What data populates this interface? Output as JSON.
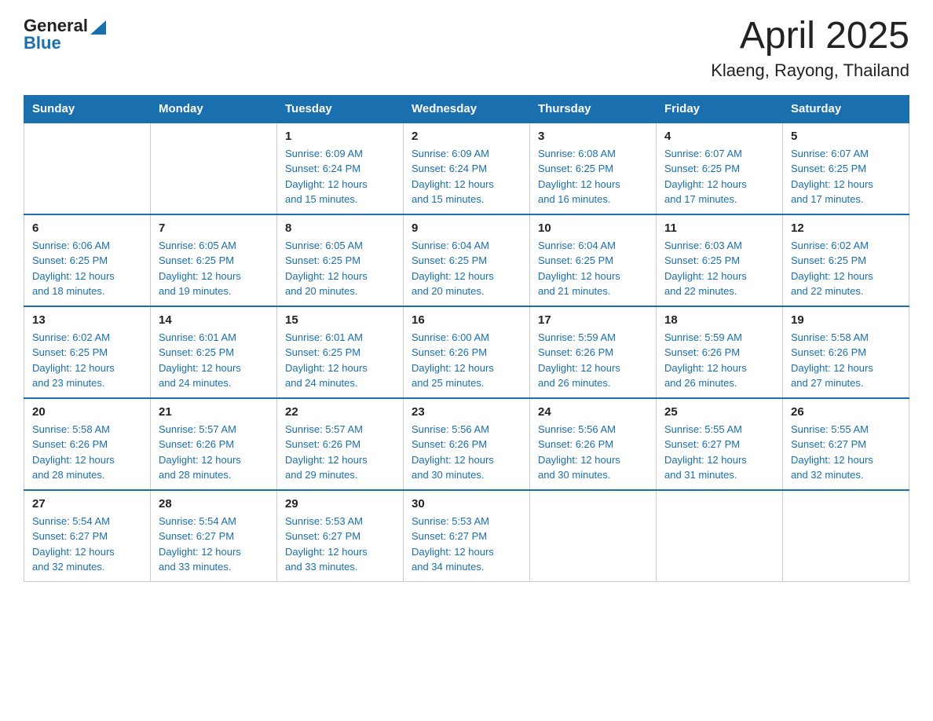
{
  "header": {
    "logo": {
      "general": "General",
      "blue": "Blue",
      "triangle": "▶"
    },
    "title": "April 2025",
    "subtitle": "Klaeng, Rayong, Thailand"
  },
  "calendar": {
    "days_of_week": [
      "Sunday",
      "Monday",
      "Tuesday",
      "Wednesday",
      "Thursday",
      "Friday",
      "Saturday"
    ],
    "weeks": [
      [
        {
          "day": "",
          "info": ""
        },
        {
          "day": "",
          "info": ""
        },
        {
          "day": "1",
          "info": "Sunrise: 6:09 AM\nSunset: 6:24 PM\nDaylight: 12 hours\nand 15 minutes."
        },
        {
          "day": "2",
          "info": "Sunrise: 6:09 AM\nSunset: 6:24 PM\nDaylight: 12 hours\nand 15 minutes."
        },
        {
          "day": "3",
          "info": "Sunrise: 6:08 AM\nSunset: 6:25 PM\nDaylight: 12 hours\nand 16 minutes."
        },
        {
          "day": "4",
          "info": "Sunrise: 6:07 AM\nSunset: 6:25 PM\nDaylight: 12 hours\nand 17 minutes."
        },
        {
          "day": "5",
          "info": "Sunrise: 6:07 AM\nSunset: 6:25 PM\nDaylight: 12 hours\nand 17 minutes."
        }
      ],
      [
        {
          "day": "6",
          "info": "Sunrise: 6:06 AM\nSunset: 6:25 PM\nDaylight: 12 hours\nand 18 minutes."
        },
        {
          "day": "7",
          "info": "Sunrise: 6:05 AM\nSunset: 6:25 PM\nDaylight: 12 hours\nand 19 minutes."
        },
        {
          "day": "8",
          "info": "Sunrise: 6:05 AM\nSunset: 6:25 PM\nDaylight: 12 hours\nand 20 minutes."
        },
        {
          "day": "9",
          "info": "Sunrise: 6:04 AM\nSunset: 6:25 PM\nDaylight: 12 hours\nand 20 minutes."
        },
        {
          "day": "10",
          "info": "Sunrise: 6:04 AM\nSunset: 6:25 PM\nDaylight: 12 hours\nand 21 minutes."
        },
        {
          "day": "11",
          "info": "Sunrise: 6:03 AM\nSunset: 6:25 PM\nDaylight: 12 hours\nand 22 minutes."
        },
        {
          "day": "12",
          "info": "Sunrise: 6:02 AM\nSunset: 6:25 PM\nDaylight: 12 hours\nand 22 minutes."
        }
      ],
      [
        {
          "day": "13",
          "info": "Sunrise: 6:02 AM\nSunset: 6:25 PM\nDaylight: 12 hours\nand 23 minutes."
        },
        {
          "day": "14",
          "info": "Sunrise: 6:01 AM\nSunset: 6:25 PM\nDaylight: 12 hours\nand 24 minutes."
        },
        {
          "day": "15",
          "info": "Sunrise: 6:01 AM\nSunset: 6:25 PM\nDaylight: 12 hours\nand 24 minutes."
        },
        {
          "day": "16",
          "info": "Sunrise: 6:00 AM\nSunset: 6:26 PM\nDaylight: 12 hours\nand 25 minutes."
        },
        {
          "day": "17",
          "info": "Sunrise: 5:59 AM\nSunset: 6:26 PM\nDaylight: 12 hours\nand 26 minutes."
        },
        {
          "day": "18",
          "info": "Sunrise: 5:59 AM\nSunset: 6:26 PM\nDaylight: 12 hours\nand 26 minutes."
        },
        {
          "day": "19",
          "info": "Sunrise: 5:58 AM\nSunset: 6:26 PM\nDaylight: 12 hours\nand 27 minutes."
        }
      ],
      [
        {
          "day": "20",
          "info": "Sunrise: 5:58 AM\nSunset: 6:26 PM\nDaylight: 12 hours\nand 28 minutes."
        },
        {
          "day": "21",
          "info": "Sunrise: 5:57 AM\nSunset: 6:26 PM\nDaylight: 12 hours\nand 28 minutes."
        },
        {
          "day": "22",
          "info": "Sunrise: 5:57 AM\nSunset: 6:26 PM\nDaylight: 12 hours\nand 29 minutes."
        },
        {
          "day": "23",
          "info": "Sunrise: 5:56 AM\nSunset: 6:26 PM\nDaylight: 12 hours\nand 30 minutes."
        },
        {
          "day": "24",
          "info": "Sunrise: 5:56 AM\nSunset: 6:26 PM\nDaylight: 12 hours\nand 30 minutes."
        },
        {
          "day": "25",
          "info": "Sunrise: 5:55 AM\nSunset: 6:27 PM\nDaylight: 12 hours\nand 31 minutes."
        },
        {
          "day": "26",
          "info": "Sunrise: 5:55 AM\nSunset: 6:27 PM\nDaylight: 12 hours\nand 32 minutes."
        }
      ],
      [
        {
          "day": "27",
          "info": "Sunrise: 5:54 AM\nSunset: 6:27 PM\nDaylight: 12 hours\nand 32 minutes."
        },
        {
          "day": "28",
          "info": "Sunrise: 5:54 AM\nSunset: 6:27 PM\nDaylight: 12 hours\nand 33 minutes."
        },
        {
          "day": "29",
          "info": "Sunrise: 5:53 AM\nSunset: 6:27 PM\nDaylight: 12 hours\nand 33 minutes."
        },
        {
          "day": "30",
          "info": "Sunrise: 5:53 AM\nSunset: 6:27 PM\nDaylight: 12 hours\nand 34 minutes."
        },
        {
          "day": "",
          "info": ""
        },
        {
          "day": "",
          "info": ""
        },
        {
          "day": "",
          "info": ""
        }
      ]
    ]
  }
}
